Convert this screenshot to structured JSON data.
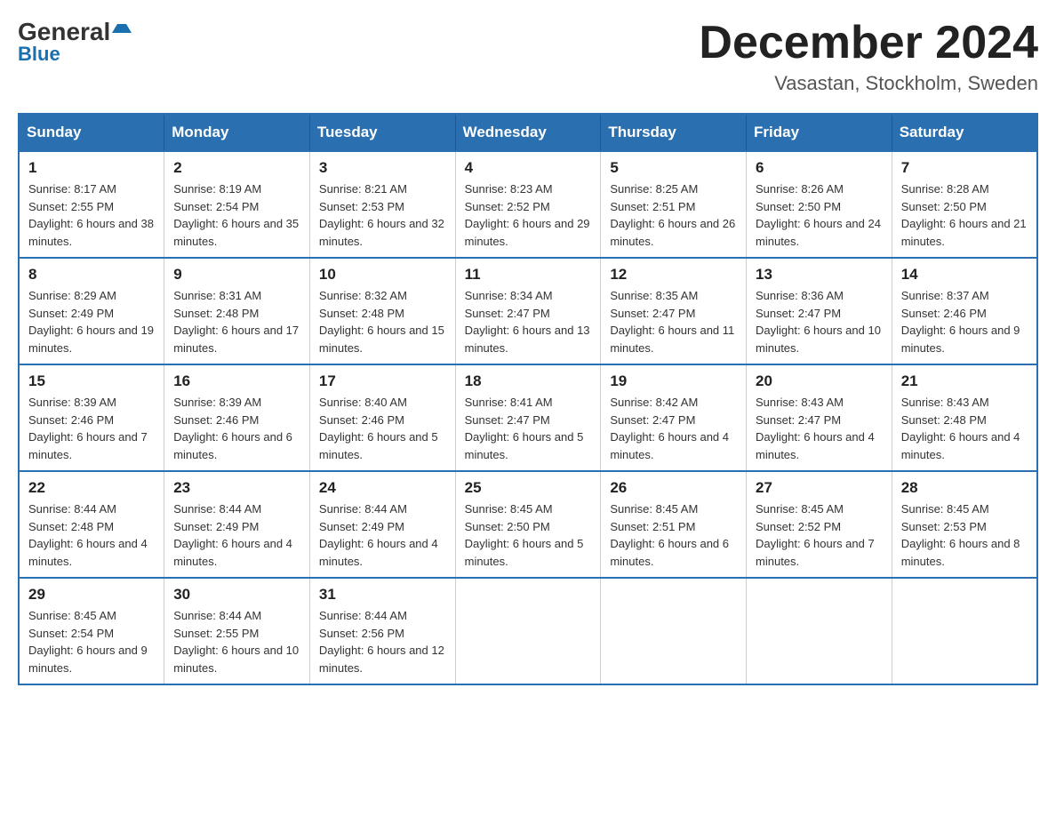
{
  "header": {
    "logo_general": "General",
    "logo_blue": "Blue",
    "month_title": "December 2024",
    "location": "Vasastan, Stockholm, Sweden"
  },
  "days_of_week": [
    "Sunday",
    "Monday",
    "Tuesday",
    "Wednesday",
    "Thursday",
    "Friday",
    "Saturday"
  ],
  "weeks": [
    [
      {
        "num": "1",
        "sunrise": "8:17 AM",
        "sunset": "2:55 PM",
        "daylight": "6 hours and 38 minutes."
      },
      {
        "num": "2",
        "sunrise": "8:19 AM",
        "sunset": "2:54 PM",
        "daylight": "6 hours and 35 minutes."
      },
      {
        "num": "3",
        "sunrise": "8:21 AM",
        "sunset": "2:53 PM",
        "daylight": "6 hours and 32 minutes."
      },
      {
        "num": "4",
        "sunrise": "8:23 AM",
        "sunset": "2:52 PM",
        "daylight": "6 hours and 29 minutes."
      },
      {
        "num": "5",
        "sunrise": "8:25 AM",
        "sunset": "2:51 PM",
        "daylight": "6 hours and 26 minutes."
      },
      {
        "num": "6",
        "sunrise": "8:26 AM",
        "sunset": "2:50 PM",
        "daylight": "6 hours and 24 minutes."
      },
      {
        "num": "7",
        "sunrise": "8:28 AM",
        "sunset": "2:50 PM",
        "daylight": "6 hours and 21 minutes."
      }
    ],
    [
      {
        "num": "8",
        "sunrise": "8:29 AM",
        "sunset": "2:49 PM",
        "daylight": "6 hours and 19 minutes."
      },
      {
        "num": "9",
        "sunrise": "8:31 AM",
        "sunset": "2:48 PM",
        "daylight": "6 hours and 17 minutes."
      },
      {
        "num": "10",
        "sunrise": "8:32 AM",
        "sunset": "2:48 PM",
        "daylight": "6 hours and 15 minutes."
      },
      {
        "num": "11",
        "sunrise": "8:34 AM",
        "sunset": "2:47 PM",
        "daylight": "6 hours and 13 minutes."
      },
      {
        "num": "12",
        "sunrise": "8:35 AM",
        "sunset": "2:47 PM",
        "daylight": "6 hours and 11 minutes."
      },
      {
        "num": "13",
        "sunrise": "8:36 AM",
        "sunset": "2:47 PM",
        "daylight": "6 hours and 10 minutes."
      },
      {
        "num": "14",
        "sunrise": "8:37 AM",
        "sunset": "2:46 PM",
        "daylight": "6 hours and 9 minutes."
      }
    ],
    [
      {
        "num": "15",
        "sunrise": "8:39 AM",
        "sunset": "2:46 PM",
        "daylight": "6 hours and 7 minutes."
      },
      {
        "num": "16",
        "sunrise": "8:39 AM",
        "sunset": "2:46 PM",
        "daylight": "6 hours and 6 minutes."
      },
      {
        "num": "17",
        "sunrise": "8:40 AM",
        "sunset": "2:46 PM",
        "daylight": "6 hours and 5 minutes."
      },
      {
        "num": "18",
        "sunrise": "8:41 AM",
        "sunset": "2:47 PM",
        "daylight": "6 hours and 5 minutes."
      },
      {
        "num": "19",
        "sunrise": "8:42 AM",
        "sunset": "2:47 PM",
        "daylight": "6 hours and 4 minutes."
      },
      {
        "num": "20",
        "sunrise": "8:43 AM",
        "sunset": "2:47 PM",
        "daylight": "6 hours and 4 minutes."
      },
      {
        "num": "21",
        "sunrise": "8:43 AM",
        "sunset": "2:48 PM",
        "daylight": "6 hours and 4 minutes."
      }
    ],
    [
      {
        "num": "22",
        "sunrise": "8:44 AM",
        "sunset": "2:48 PM",
        "daylight": "6 hours and 4 minutes."
      },
      {
        "num": "23",
        "sunrise": "8:44 AM",
        "sunset": "2:49 PM",
        "daylight": "6 hours and 4 minutes."
      },
      {
        "num": "24",
        "sunrise": "8:44 AM",
        "sunset": "2:49 PM",
        "daylight": "6 hours and 4 minutes."
      },
      {
        "num": "25",
        "sunrise": "8:45 AM",
        "sunset": "2:50 PM",
        "daylight": "6 hours and 5 minutes."
      },
      {
        "num": "26",
        "sunrise": "8:45 AM",
        "sunset": "2:51 PM",
        "daylight": "6 hours and 6 minutes."
      },
      {
        "num": "27",
        "sunrise": "8:45 AM",
        "sunset": "2:52 PM",
        "daylight": "6 hours and 7 minutes."
      },
      {
        "num": "28",
        "sunrise": "8:45 AM",
        "sunset": "2:53 PM",
        "daylight": "6 hours and 8 minutes."
      }
    ],
    [
      {
        "num": "29",
        "sunrise": "8:45 AM",
        "sunset": "2:54 PM",
        "daylight": "6 hours and 9 minutes."
      },
      {
        "num": "30",
        "sunrise": "8:44 AM",
        "sunset": "2:55 PM",
        "daylight": "6 hours and 10 minutes."
      },
      {
        "num": "31",
        "sunrise": "8:44 AM",
        "sunset": "2:56 PM",
        "daylight": "6 hours and 12 minutes."
      },
      null,
      null,
      null,
      null
    ]
  ]
}
